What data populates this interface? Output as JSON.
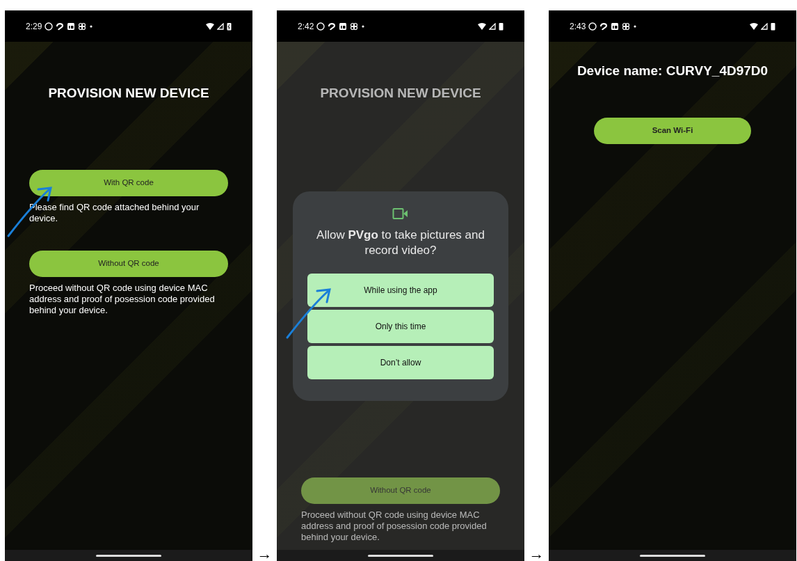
{
  "screens": [
    {
      "status_bar": {
        "time": "2:29",
        "battery_charging": true
      },
      "title": "PROVISION NEW DEVICE",
      "kind": "menu",
      "dimmed": false,
      "pointer_arrow": true,
      "options": [
        {
          "button": "With QR code",
          "description": "Please find QR code attached behind your device."
        },
        {
          "button": "Without QR code",
          "description": "Proceed without QR code using device MAC address and proof of posession code provided behind your device."
        }
      ]
    },
    {
      "status_bar": {
        "time": "2:42",
        "battery_charging": false
      },
      "title": "PROVISION NEW DEVICE",
      "kind": "menu",
      "dimmed": true,
      "pointer_arrow": false,
      "options": [
        {
          "button": "Without QR code",
          "description": "Proceed without QR code using device MAC address and proof of posession code provided behind your device."
        }
      ],
      "dialog": {
        "title": "Allow **PVgo** to take pictures and record video?",
        "pointer_arrow": true,
        "buttons": [
          "While using the app",
          "Only this time",
          "Don’t allow"
        ]
      }
    },
    {
      "status_bar": {
        "time": "2:43",
        "battery_charging": false
      },
      "title": "Device name: CURVY_4D97D0",
      "kind": "device",
      "dimmed": false,
      "pointer_arrow": false,
      "options": [
        {
          "button": "Scan Wi-Fi"
        }
      ]
    }
  ],
  "flow_arrows": [
    "→",
    "→"
  ]
}
